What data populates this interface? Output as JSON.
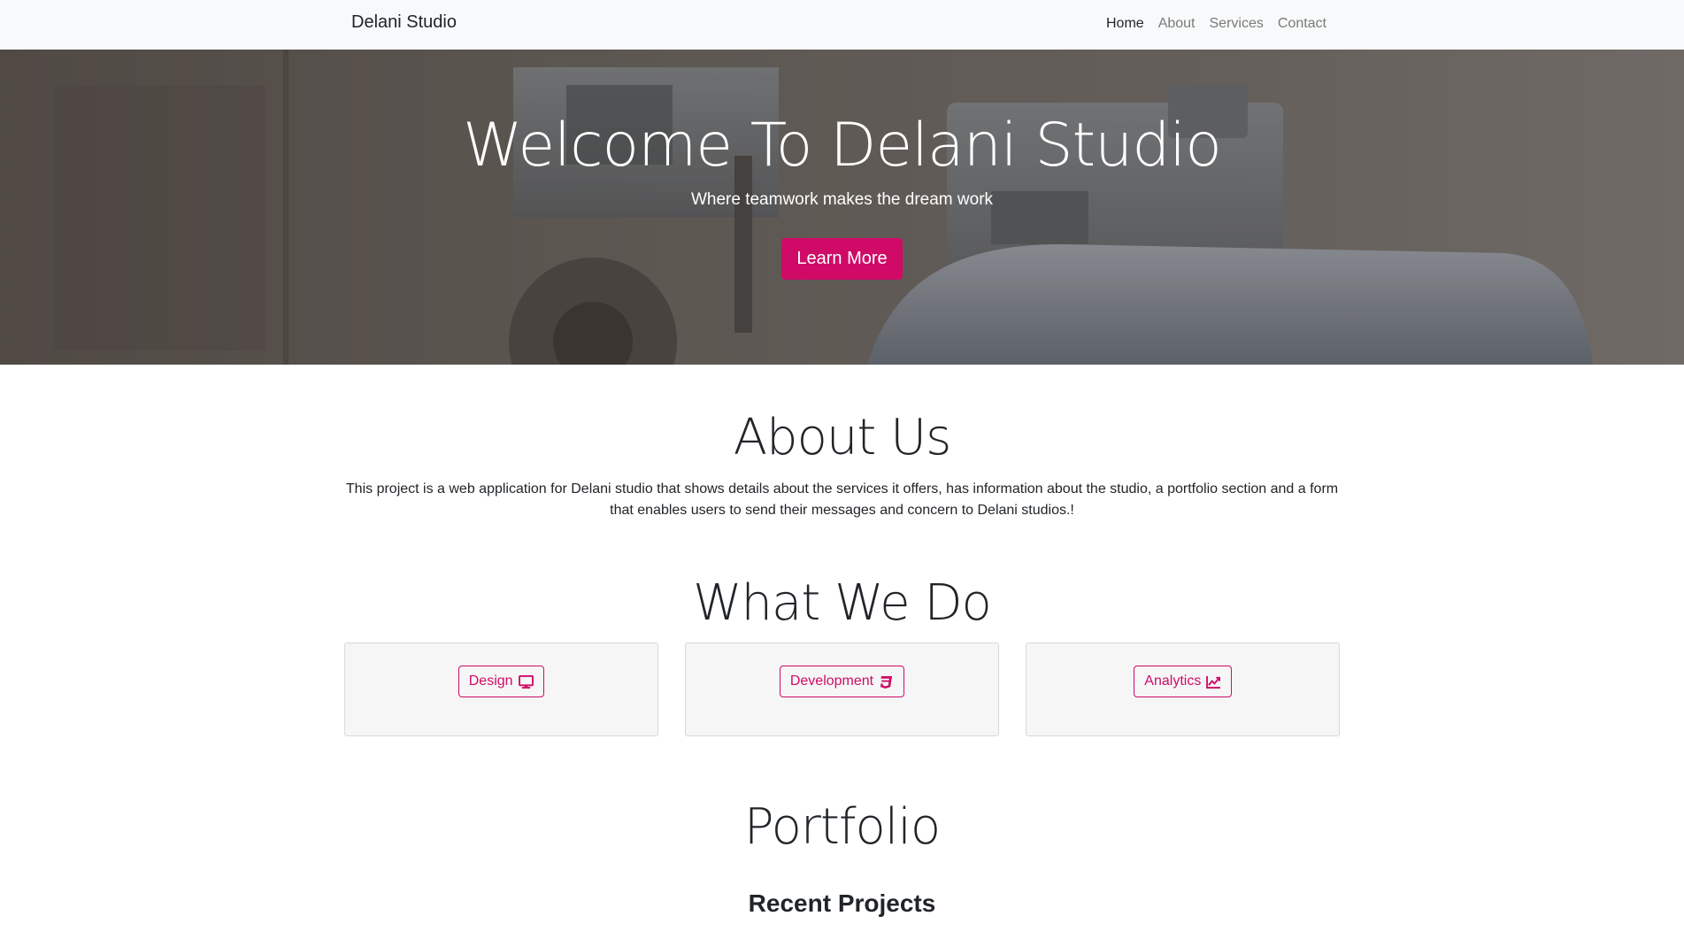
{
  "navbar": {
    "brand": "Delani Studio",
    "links": [
      {
        "label": "Home",
        "active": true
      },
      {
        "label": "About",
        "active": false
      },
      {
        "label": "Services",
        "active": false
      },
      {
        "label": "Contact",
        "active": false
      }
    ]
  },
  "hero": {
    "title": "Welcome To Delani Studio",
    "subtitle": "Where teamwork makes the dream work",
    "button_label": "Learn More",
    "accent": "#cf0b67"
  },
  "about": {
    "title": "About Us",
    "text": "This project is a web application for Delani studio that shows details about the services it offers, has information about the studio, a portfolio section and a form that enables users to send their messages and concern to Delani studios.!"
  },
  "services": {
    "title": "What We Do",
    "cards": [
      {
        "label": "Design",
        "icon": "desktop-icon"
      },
      {
        "label": "Development",
        "icon": "css3-icon"
      },
      {
        "label": "Analytics",
        "icon": "chart-line-icon"
      }
    ]
  },
  "portfolio": {
    "title": "Portfolio",
    "subtitle": "Recent Projects"
  }
}
